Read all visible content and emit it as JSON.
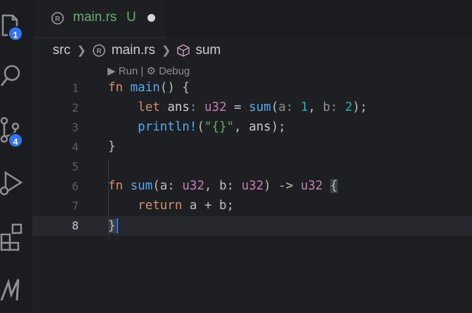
{
  "activity_bar": {
    "items": [
      {
        "icon": "files-icon",
        "badge": "1"
      },
      {
        "icon": "search-icon"
      },
      {
        "icon": "source-control-icon",
        "badge": "4"
      },
      {
        "icon": "run-debug-icon"
      },
      {
        "icon": "extensions-icon"
      },
      {
        "icon": "testing-icon"
      }
    ]
  },
  "tab": {
    "icon": "rust-icon",
    "label": "main.rs",
    "status": "U"
  },
  "breadcrumb": {
    "items": [
      "src",
      "main.rs",
      "sum"
    ]
  },
  "codelens": {
    "run": "Run",
    "separator": "|",
    "debug": "Debug"
  },
  "editor": {
    "line_numbers": [
      "1",
      "2",
      "3",
      "4",
      "5",
      "6",
      "7",
      "8"
    ],
    "current_line": "8",
    "lines": [
      "fn main() {",
      "    let ans: u32 = sum(a: 1, b: 2);",
      "    println!(\"{}\", ans);",
      "}",
      "",
      "fn sum(a: u32, b: u32) -> u32 {",
      "    return a + b;",
      "}"
    ]
  },
  "colors": {
    "keyword": "#cf8e6d",
    "function": "#56a8f5",
    "type": "#c77dbb",
    "number": "#2aacb8",
    "string": "#6aab73",
    "untracked": "#6aab73",
    "badge": "#3574f0"
  }
}
